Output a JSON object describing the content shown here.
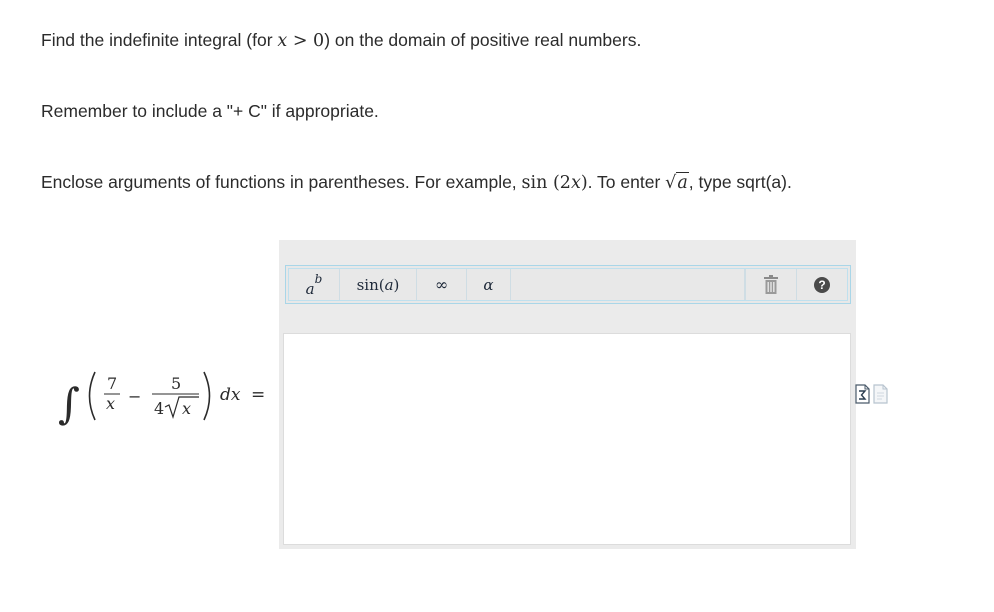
{
  "instructions": {
    "line1_prefix": "Find the indefinite integral (for ",
    "line1_math_var": "x",
    "line1_math_rel": " > 0",
    "line1_suffix": ") on the domain of positive real numbers.",
    "line2": "Remember to include a \"+ C\" if appropriate.",
    "line3_prefix": "Enclose arguments of functions in parentheses. For example, ",
    "line3_example_fn": "sin",
    "line3_example_arg_open": " (2",
    "line3_example_var": "x",
    "line3_example_arg_close": ")",
    "line3_mid": ". To enter ",
    "line3_sqrt_var": "a",
    "line3_suffix": ", type sqrt(a)."
  },
  "toolbar": {
    "power_base": "a",
    "power_exp": "b",
    "sin_label": "sin",
    "sin_arg_open": " (",
    "sin_arg_var": "a",
    "sin_arg_close": ")",
    "infinity_label": "∞",
    "alpha_label": "α",
    "trash_icon": "trash-icon",
    "help_icon": "help-icon",
    "help_label": "?"
  },
  "integral": {
    "integral_sign": "∫",
    "num1": "7",
    "den1_var": "x",
    "minus": "−",
    "num2": "5",
    "den2_coef": "4",
    "den2_var": "x",
    "dx": "dx",
    "equals": "="
  },
  "answer": {
    "value": ""
  },
  "side_icons": [
    "math-entry-icon",
    "document-icon"
  ],
  "colors": {
    "toolbar_border": "#a9d6e8",
    "editor_bg": "#ebebeb",
    "text": "#2b2b2b"
  }
}
